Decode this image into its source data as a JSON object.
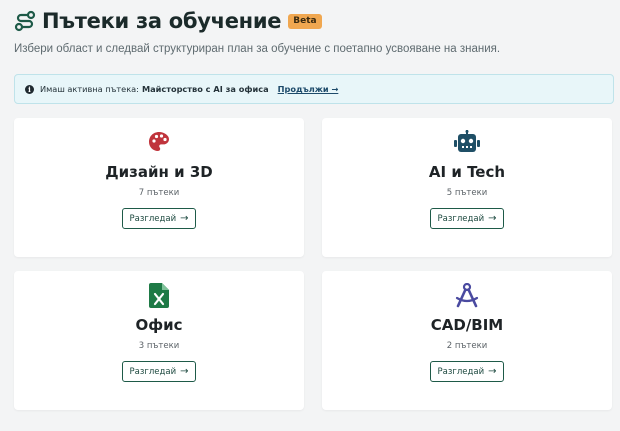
{
  "header": {
    "title": "Пътеки за обучение",
    "badge": "Beta",
    "subtitle": "Избери област и следвай структуриран план за обучение с поетапно усвояване на знания."
  },
  "banner": {
    "prefix": "Имаш активна пътека:",
    "path_name": "Майсторство с AI за офиса",
    "link": "Продължи →"
  },
  "colors": {
    "accent": "#1e5a48",
    "icon_design": "#c0343c",
    "icon_ai": "#1f4f66",
    "icon_office": "#1e7a46",
    "icon_cad": "#4a4aa0",
    "badge": "#f0a750"
  },
  "categories": [
    {
      "icon": "palette-icon",
      "title": "Дизайн и 3D",
      "count": "7 пътеки",
      "button": "Разгледай"
    },
    {
      "icon": "robot-icon",
      "title": "AI и Tech",
      "count": "5 пътеки",
      "button": "Разгледай"
    },
    {
      "icon": "excel-file-icon",
      "title": "Офис",
      "count": "3 пътеки",
      "button": "Разгледай"
    },
    {
      "icon": "drafting-compass-icon",
      "title": "CAD/BIM",
      "count": "2 пътеки",
      "button": "Разгледай"
    }
  ]
}
